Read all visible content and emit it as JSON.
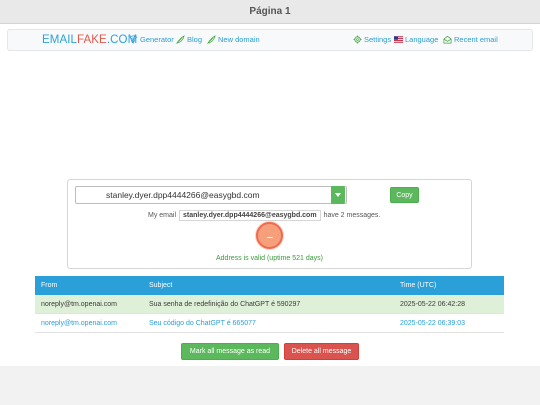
{
  "window": {
    "title": "Página 1"
  },
  "nav": {
    "logo_part1": "EMAIL",
    "logo_part2": "FAKE",
    "logo_part3": ".COM",
    "generator": "Generator",
    "blog": "Blog",
    "new_domain": "New domain",
    "settings": "Settings",
    "language": "Language",
    "recent_email": "Recent email"
  },
  "inbox": {
    "selected_email": "stanley.dyer.dpp4444266@easygbd.com",
    "copy_label": "Copy",
    "my_email_prefix": "My email",
    "my_email_address": "stanley.dyer.dpp4444266@easygbd.com",
    "my_email_suffix": "have 2 messages.",
    "status": "Address is valid (uptime 521 days)"
  },
  "table": {
    "headers": [
      "From",
      "Subject",
      "Time (UTC)"
    ],
    "rows": [
      {
        "from": "noreply@tm.openai.com",
        "subject": "Sua senha de redefinição do ChatGPT é 590297",
        "time": "2025-05-22 06:42:28",
        "unread": true
      },
      {
        "from": "noreply@tm.openai.com",
        "subject": "Seu código do ChatGPT é 665077",
        "time": "2025-05-22 06:39:03",
        "unread": false
      }
    ]
  },
  "actions": {
    "mark_read": "Mark all message as read",
    "delete_all": "Delete all message"
  },
  "colors": {
    "accent": "#2a9fd8",
    "brand_red": "#e25a4d",
    "success": "#5cb85c",
    "danger": "#d9534f"
  },
  "icons": [
    "generator-icon",
    "blog-icon",
    "new-domain-icon",
    "settings-icon",
    "flag-us-icon",
    "envelope-open-icon"
  ]
}
